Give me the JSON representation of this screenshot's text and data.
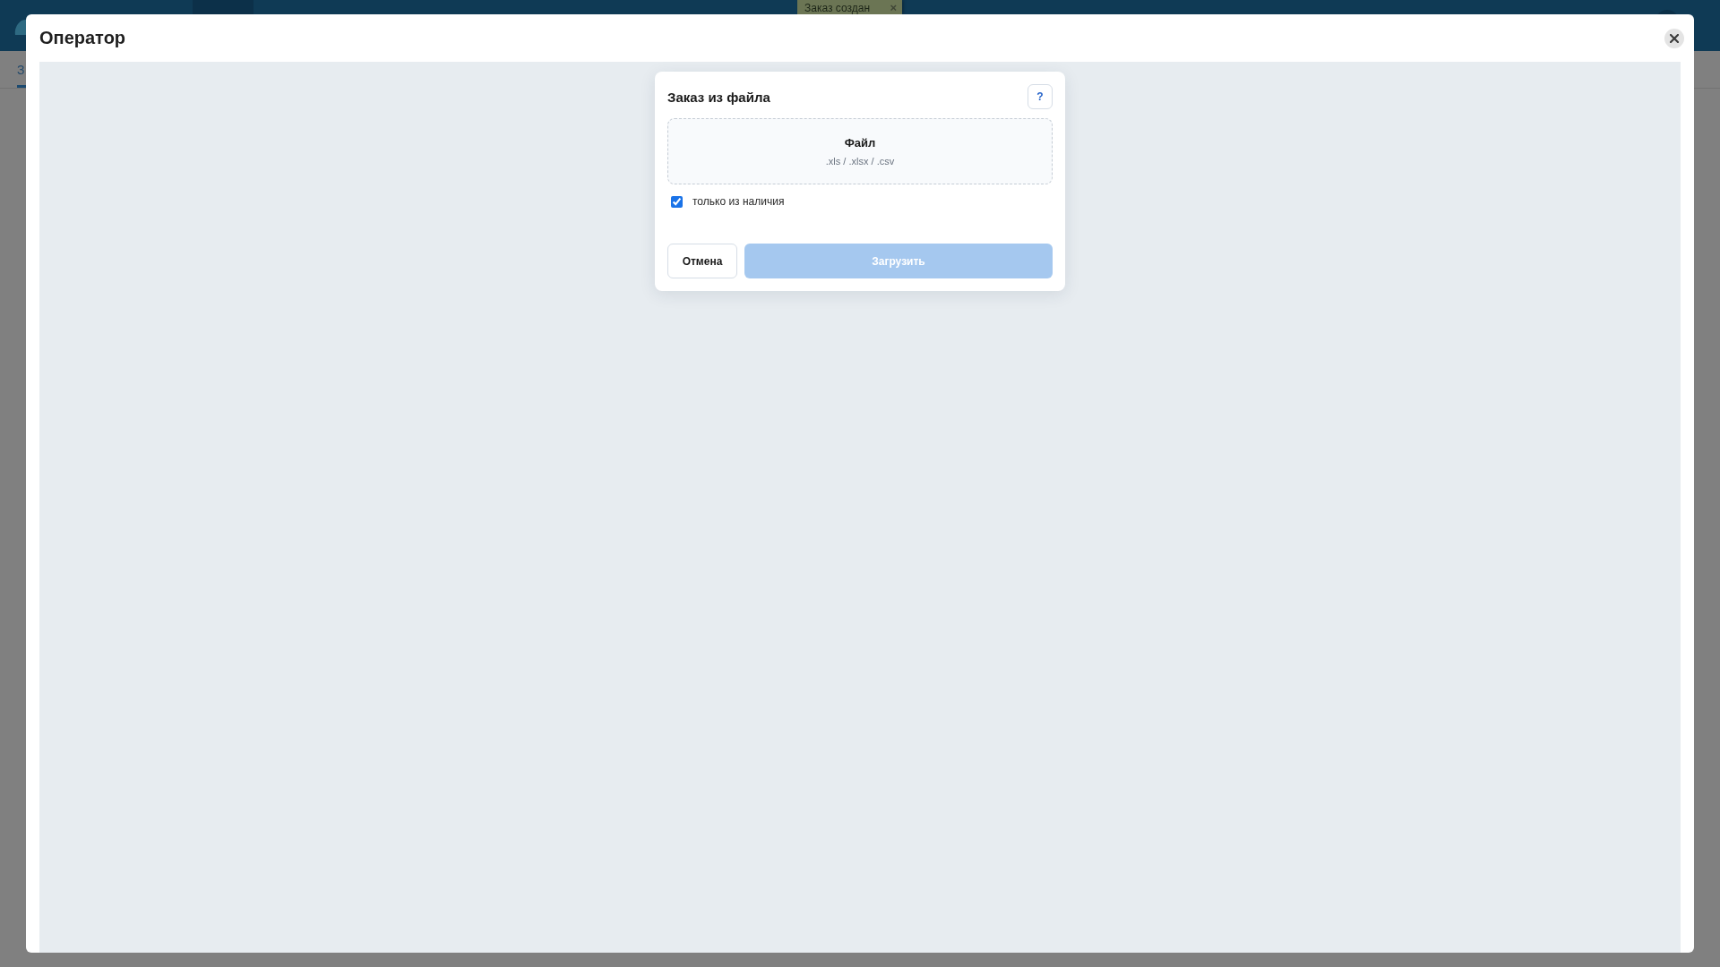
{
  "background_page": {
    "notification": {
      "text": "Заказ создан",
      "close": "×"
    },
    "tabs": [
      {
        "label": "З",
        "selected": true
      }
    ]
  },
  "modal": {
    "title": "Оператор"
  },
  "dialog": {
    "title": "Заказ из файла",
    "help_button": "?",
    "drop_zone": {
      "label": "Файл",
      "hint": ".xls / .xlsx / .csv"
    },
    "only_in_stock": {
      "label": "только из наличия",
      "checked": true
    },
    "buttons": [
      {
        "label": "Отмена",
        "kind": "secondary",
        "disabled": false
      },
      {
        "label": "Загрузить",
        "kind": "primary",
        "disabled": true
      }
    ]
  }
}
